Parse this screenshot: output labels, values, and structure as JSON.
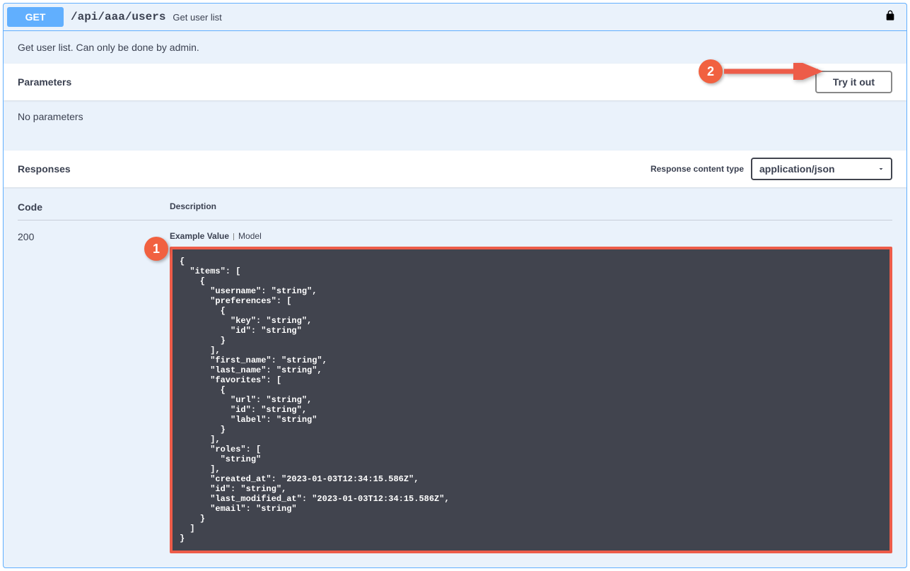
{
  "header": {
    "method": "GET",
    "path": "/api/aaa/users",
    "summary": "Get user list"
  },
  "description": "Get user list. Can only be done by admin.",
  "parameters": {
    "title": "Parameters",
    "try_it_out_label": "Try it out",
    "empty_message": "No parameters"
  },
  "responses": {
    "title": "Responses",
    "content_type_label": "Response content type",
    "content_type_value": "application/json",
    "columns": {
      "code": "Code",
      "description": "Description"
    },
    "row": {
      "code": "200",
      "tabs": {
        "example_value": "Example Value",
        "model": "Model"
      },
      "example": "{\n  \"items\": [\n    {\n      \"username\": \"string\",\n      \"preferences\": [\n        {\n          \"key\": \"string\",\n          \"id\": \"string\"\n        }\n      ],\n      \"first_name\": \"string\",\n      \"last_name\": \"string\",\n      \"favorites\": [\n        {\n          \"url\": \"string\",\n          \"id\": \"string\",\n          \"label\": \"string\"\n        }\n      ],\n      \"roles\": [\n        \"string\"\n      ],\n      \"created_at\": \"2023-01-03T12:34:15.586Z\",\n      \"id\": \"string\",\n      \"last_modified_at\": \"2023-01-03T12:34:15.586Z\",\n      \"email\": \"string\"\n    }\n  ]\n}"
    }
  },
  "annotations": {
    "one": "1",
    "two": "2"
  }
}
